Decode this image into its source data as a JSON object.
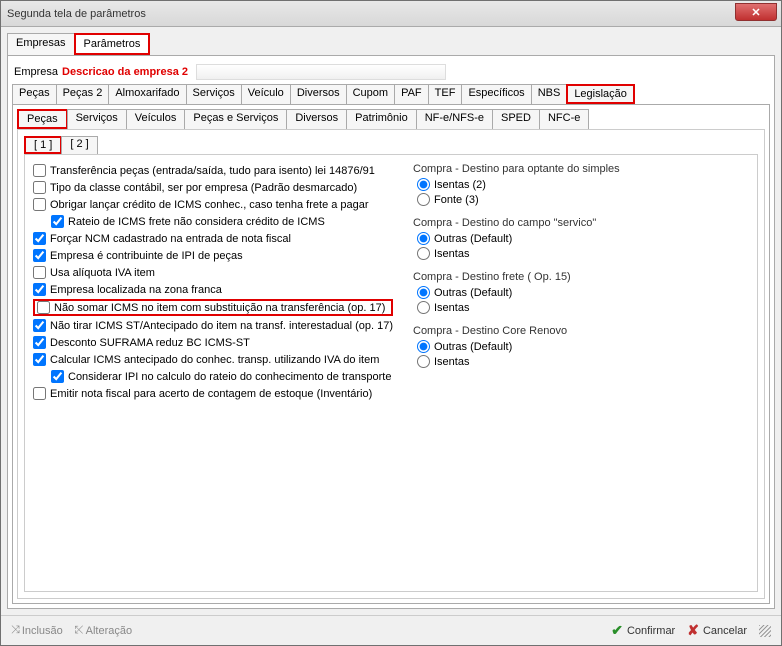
{
  "title": "Segunda tela de parâmetros",
  "topTabs": {
    "empresas": "Empresas",
    "parametros": "Parâmetros"
  },
  "empresa": {
    "label": "Empresa",
    "desc": "Descricao da empresa 2"
  },
  "catTabs": {
    "pecas": "Peças",
    "pecas2": "Peças 2",
    "almox": "Almoxarifado",
    "servicos": "Serviços",
    "veiculo": "Veículo",
    "diversos": "Diversos",
    "cupom": "Cupom",
    "paf": "PAF",
    "tef": "TEF",
    "especificos": "Específicos",
    "nbs": "NBS",
    "legislacao": "Legislação"
  },
  "subTabs": {
    "pecas": "Peças",
    "servicos": "Serviços",
    "veiculos": "Veículos",
    "pecasServ": "Peças e Serviços",
    "diversos": "Diversos",
    "patrimonio": "Patrimônio",
    "nfenfse": "NF-e/NFS-e",
    "sped": "SPED",
    "nfce": "NFC-e"
  },
  "numTabs": {
    "t1": "[ 1 ]",
    "t2": "[ 2 ]"
  },
  "checks": {
    "c1": "Transferência peças (entrada/saída, tudo para isento) lei 14876/91",
    "c2": "Tipo da classe contábil, ser por empresa (Padrão desmarcado)",
    "c3": "Obrigar lançar crédito de ICMS conhec., caso tenha frete a pagar",
    "c4": "Rateio de ICMS frete não considera crédito de ICMS",
    "c5": "Forçar NCM cadastrado na entrada de nota fiscal",
    "c6": "Empresa é contribuinte de IPI de peças",
    "c7": "Usa alíquota IVA item",
    "c8": "Empresa localizada na zona franca",
    "c9": "Não somar ICMS no item com substituição na transferência (op. 17)",
    "c10": "Não tirar ICMS ST/Antecipado do item na transf. interestadual (op. 17)",
    "c11": "Desconto SUFRAMA reduz BC ICMS-ST",
    "c12": "Calcular ICMS antecipado do conhec. transp. utilizando IVA do item",
    "c13": "Considerar IPI no calculo do rateio do conhecimento de transporte",
    "c14": "Emitir nota fiscal para acerto de contagem de estoque (Inventário)"
  },
  "radioGroups": {
    "g1": {
      "title": "Compra - Destino para optante do simples",
      "o1": "Isentas (2)",
      "o2": "Fonte (3)"
    },
    "g2": {
      "title": "Compra - Destino do campo \"servico\"",
      "o1": "Outras (Default)",
      "o2": "Isentas"
    },
    "g3": {
      "title": "Compra - Destino frete ( Op. 15)",
      "o1": "Outras (Default)",
      "o2": "Isentas"
    },
    "g4": {
      "title": "Compra - Destino Core Renovo",
      "o1": "Outras (Default)",
      "o2": "Isentas"
    }
  },
  "footer": {
    "inclusao": "Inclusão",
    "alteracao": "Alteração",
    "confirmar": "Confirmar",
    "cancelar": "Cancelar"
  }
}
